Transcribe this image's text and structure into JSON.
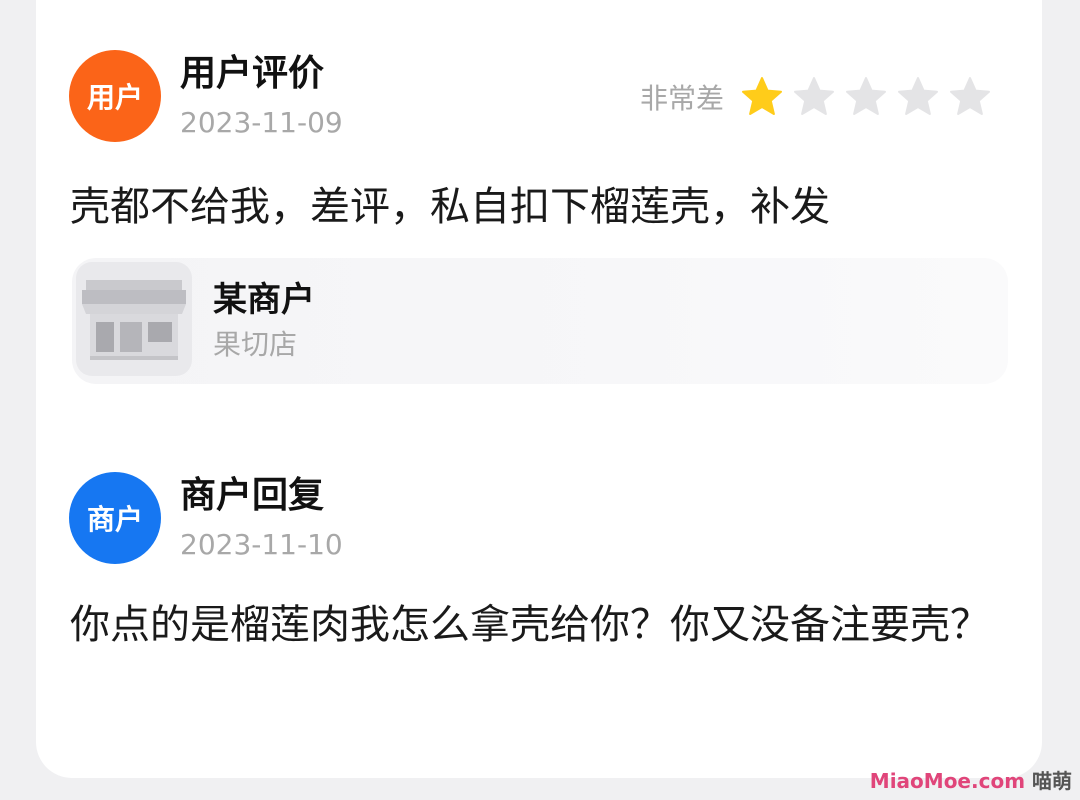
{
  "review": {
    "avatar_label": "用户",
    "avatar_color": "#fb6418",
    "title": "用户评价",
    "date": "2023-11-09",
    "rating_label": "非常差",
    "rating": 1,
    "rating_max": 5,
    "star_filled_color": "#ffcc1a",
    "star_empty_color": "#e4e4e6",
    "text": "壳都不给我，差评，私自扣下榴莲壳，补发",
    "merchant": {
      "icon": "storefront-icon",
      "name": "某商户",
      "type": "果切店"
    }
  },
  "reply": {
    "avatar_label": "商户",
    "avatar_color": "#1677f2",
    "title": "商户回复",
    "date": "2023-11-10",
    "text": "你点的是榴莲肉我怎么拿壳给你？你又没备注要壳？"
  },
  "watermark": {
    "text": "喵萌",
    "subtext": "MiaoMoe.com"
  }
}
